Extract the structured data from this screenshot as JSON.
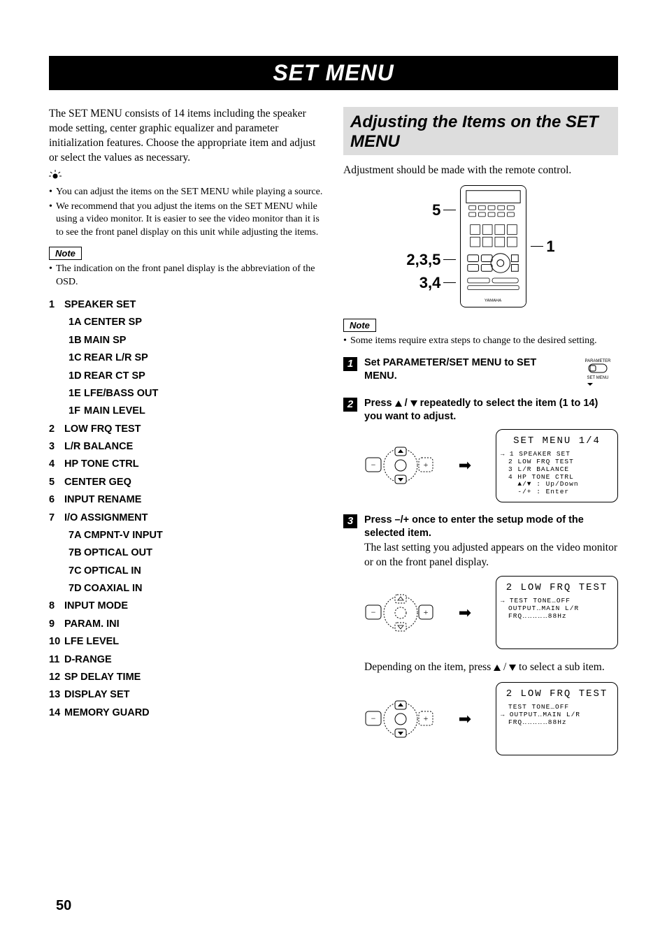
{
  "title": "SET MENU",
  "intro": "The SET MENU consists of 14 items including the speaker mode setting, center graphic equalizer and parameter initialization features. Choose the appropriate item and adjust or select the values as necessary.",
  "tips": [
    "You can adjust the items on the SET MENU while playing a source.",
    "We recommend that you adjust the items on the SET MENU while using a video monitor. It is easier to see the video monitor than it is to see the front panel display on this unit while adjusting the items."
  ],
  "note_label": "Note",
  "left_note": "The indication on the front panel display is the abbreviation of the OSD.",
  "menu": [
    {
      "n": "1",
      "t": "SPEAKER SET",
      "sub": [
        {
          "n": "1A",
          "t": "CENTER SP"
        },
        {
          "n": "1B",
          "t": "MAIN SP"
        },
        {
          "n": "1C",
          "t": "REAR L/R SP"
        },
        {
          "n": "1D",
          "t": "REAR CT SP"
        },
        {
          "n": "1E",
          "t": "LFE/BASS OUT"
        },
        {
          "n": "1F",
          "t": "MAIN LEVEL"
        }
      ]
    },
    {
      "n": "2",
      "t": "LOW FRQ TEST"
    },
    {
      "n": "3",
      "t": "L/R BALANCE"
    },
    {
      "n": "4",
      "t": "HP TONE CTRL"
    },
    {
      "n": "5",
      "t": "CENTER GEQ"
    },
    {
      "n": "6",
      "t": "INPUT RENAME"
    },
    {
      "n": "7",
      "t": "I/O ASSIGNMENT",
      "sub": [
        {
          "n": "7A",
          "t": "CMPNT-V INPUT"
        },
        {
          "n": "7B",
          "t": "OPTICAL OUT"
        },
        {
          "n": "7C",
          "t": "OPTICAL IN"
        },
        {
          "n": "7D",
          "t": "COAXIAL IN"
        }
      ]
    },
    {
      "n": "8",
      "t": "INPUT MODE"
    },
    {
      "n": "9",
      "t": "PARAM. INI"
    },
    {
      "n": "10",
      "t": "LFE LEVEL"
    },
    {
      "n": "11",
      "t": "D-RANGE"
    },
    {
      "n": "12",
      "t": "SP DELAY TIME"
    },
    {
      "n": "13",
      "t": "DISPLAY SET"
    },
    {
      "n": "14",
      "t": "MEMORY GUARD"
    }
  ],
  "right_heading": "Adjusting the Items on the SET MENU",
  "right_intro": "Adjustment should be made with the remote control.",
  "remote_callouts": {
    "top": "5",
    "mid": "2,3,5",
    "bot": "3,4",
    "right": "1"
  },
  "right_note": "Some items require extra steps to change to the desired setting.",
  "steps": {
    "s1": {
      "title": "Set PARAMETER/SET MENU to SET MENU."
    },
    "s2": {
      "title_a": "Press ",
      "title_b": " / ",
      "title_c": " repeatedly to select the item (1 to 14) you want to adjust."
    },
    "s3": {
      "title": "Press –/+ once to enter the setup mode of the selected item.",
      "desc": "The last setting you adjusted appears on the video monitor or on the front panel display."
    },
    "sub_desc_a": "Depending on the item, press ",
    "sub_desc_b": " / ",
    "sub_desc_c": " to select a sub item."
  },
  "slider": {
    "top": "PARAMETER",
    "bot": "SET MENU"
  },
  "osd1": {
    "title": "SET MENU 1/4",
    "lines": [
      "1 SPEAKER SET",
      "2 LOW FRQ TEST",
      "3 L/R BALANCE",
      "4 HP TONE CTRL",
      "  ▲/▼ : Up/Down",
      "  -/+ : Enter"
    ],
    "ptr_idx": 0
  },
  "osd2": {
    "title": "2 LOW FRQ TEST",
    "lines": [
      "TEST TONE…OFF",
      "OUTPUT‥MAIN L/R",
      "FRQ‥‥‥‥‥88Hz"
    ],
    "ptr_idx": 0
  },
  "osd3": {
    "title": "2 LOW FRQ TEST",
    "lines": [
      "TEST TONE…OFF",
      "OUTPUT‥MAIN L/R",
      "FRQ‥‥‥‥‥88Hz"
    ],
    "ptr_idx": 1
  },
  "brand": "YAMAHA",
  "page": "50"
}
